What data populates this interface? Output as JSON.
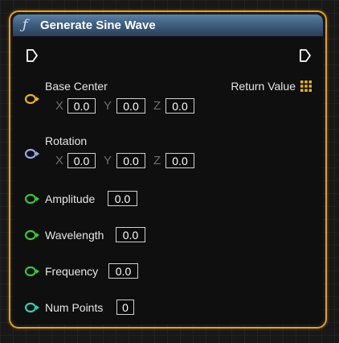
{
  "node": {
    "title": "Generate Sine Wave",
    "icon": "function-icon",
    "header_color": "#3f5e80",
    "border_color": "#e8a11c"
  },
  "pins": {
    "base_center": {
      "label": "Base Center",
      "color": "#e8b32c",
      "x_axis": "X",
      "x_value": "0.0",
      "y_axis": "Y",
      "y_value": "0.0",
      "z_axis": "Z",
      "z_value": "0.0"
    },
    "rotation": {
      "label": "Rotation",
      "color": "#9aa8e6",
      "x_axis": "X",
      "x_value": "0.0",
      "y_axis": "Y",
      "y_value": "0.0",
      "z_axis": "Z",
      "z_value": "0.0"
    },
    "amplitude": {
      "label": "Amplitude",
      "value": "0.0",
      "color": "#3cc43c"
    },
    "wavelength": {
      "label": "Wavelength",
      "value": "0.0",
      "color": "#3cc43c"
    },
    "frequency": {
      "label": "Frequency",
      "value": "0.0",
      "color": "#3cc43c"
    },
    "num_points": {
      "label": "Num Points",
      "value": "0",
      "color": "#2fd1b4"
    }
  },
  "outputs": {
    "return_value": {
      "label": "Return Value",
      "color": "#e8b32c"
    }
  }
}
